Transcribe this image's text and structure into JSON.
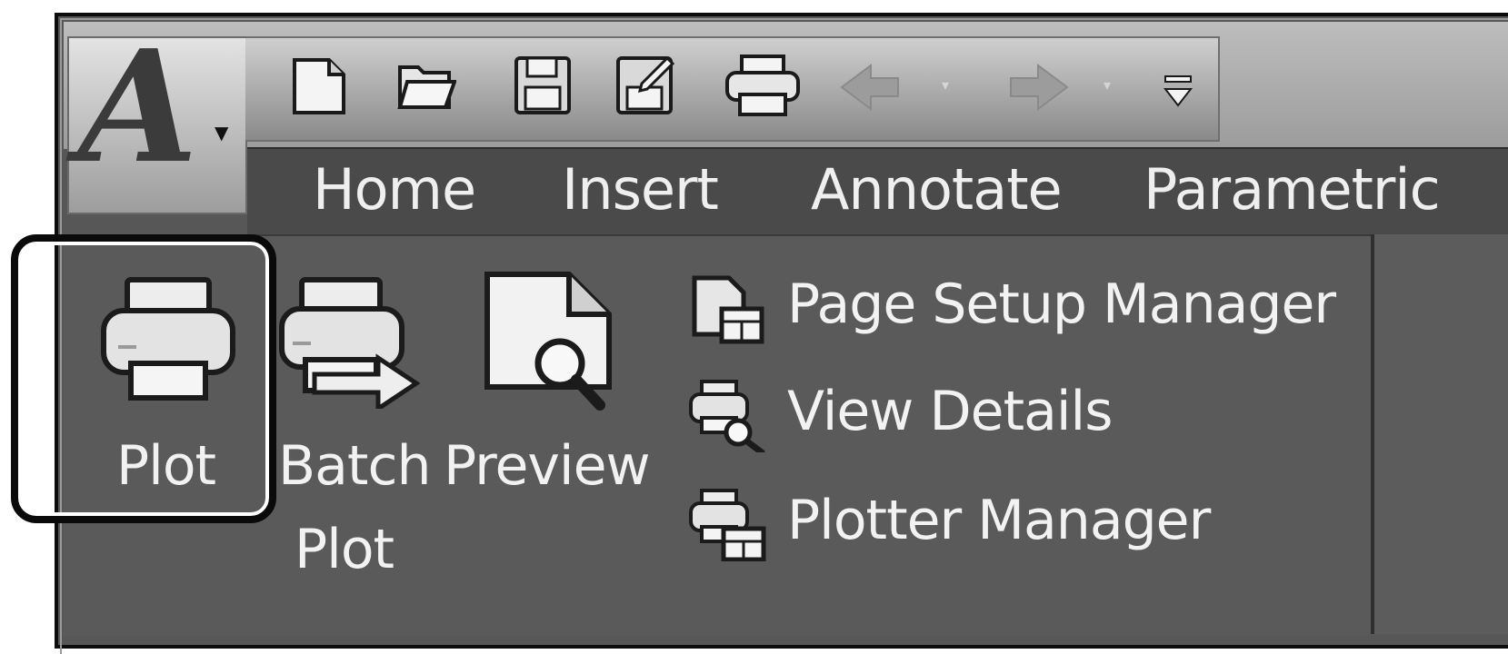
{
  "app_button": {
    "logo_letter": "A"
  },
  "quick_access": {
    "items": [
      "new-icon",
      "open-icon",
      "save-icon",
      "save-as-icon",
      "plot-icon",
      "undo-icon",
      "redo-icon",
      "customize-icon"
    ],
    "dropdown_glyph": "▾"
  },
  "ribbon_tabs": [
    "Home",
    "Insert",
    "Annotate",
    "Parametric"
  ],
  "output_panel": {
    "plot": {
      "label": "Plot",
      "icon": "printer-icon"
    },
    "batch_plot": {
      "label_line1": "Batch",
      "label_line2": "Plot",
      "icon": "batch-plot-icon"
    },
    "preview": {
      "label": "Preview",
      "icon": "preview-icon"
    },
    "small_buttons": [
      {
        "label": "Page Setup Manager",
        "icon": "page-setup-icon"
      },
      {
        "label": "View Details",
        "icon": "view-details-icon"
      },
      {
        "label": "Plotter Manager",
        "icon": "plotter-manager-icon"
      }
    ]
  },
  "highlight": {
    "target": "Plot",
    "color": "#0a0a0a"
  },
  "colors": {
    "ribbon_bg": "#5a5a5a",
    "tab_bg": "#4a4a4a",
    "text": "#f2f2f2"
  }
}
